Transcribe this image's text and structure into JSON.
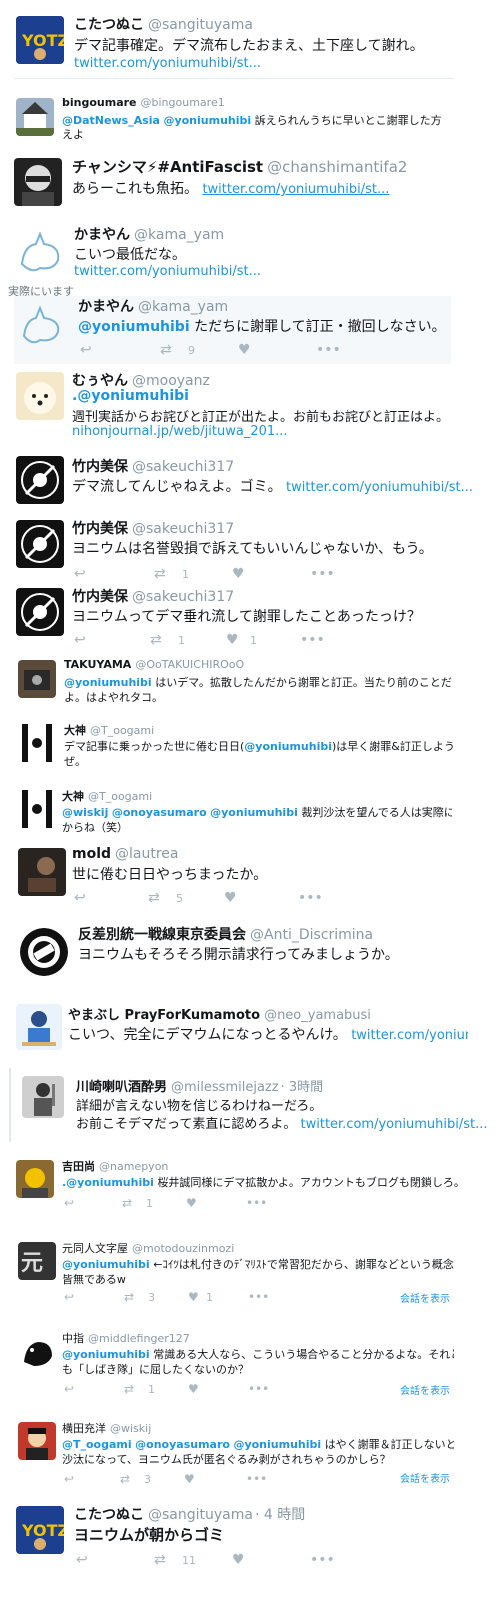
{
  "tweets": [
    {
      "name": "こたつぬこ",
      "handle": "@sangituyama",
      "text": "デマ記事確定。デマ流布したおまえ、土下座して謝れ。",
      "link": "twitter.com/yoniumuhibi/st..."
    },
    {
      "name": "bingoumare",
      "handle": "@bingoumare1",
      "mention_a": "@DatNews_Asia",
      "mention_b": "@yoniumuhibi",
      "text": "訴えられんうちに早いとこ謝罪した方がえ",
      "text2": "えよ"
    },
    {
      "name": "チャンシマ⚡#AntiFascist",
      "handle": "@chanshimantifa2",
      "text": "あらーこれも魚拓。",
      "link": "twitter.com/yoniumuhibi/st..."
    },
    {
      "name": "かまやん",
      "handle": "@kama_yam",
      "text": "こいつ最低だな。",
      "link": "twitter.com/yoniumuhibi/st..."
    },
    {
      "name": "かまやん",
      "handle": "@kama_yam",
      "mention": "@yoniumuhibi",
      "text": "ただちに謝罪して訂正・撤回しなさい。",
      "retweets": "9"
    },
    {
      "name": "むぅやん",
      "handle": "@mooyanz",
      "mention": ".@yoniumuhibi",
      "text": "週刊実話からお詫びと訂正が出たよ。お前もお詫びと訂正はよ。",
      "link": "nihonjournal.jp/web/jituwa_201..."
    },
    {
      "name": "竹内美保",
      "handle": "@sakeuchi317",
      "text": "デマ流してんじゃねえよ。ゴミ。",
      "link": "twitter.com/yoniumuhibi/st..."
    },
    {
      "name": "竹内美保",
      "handle": "@sakeuchi317",
      "text": "ヨニウムは名誉毀損で訴えてもいいんじゃないか、もう。",
      "retweets": "1"
    },
    {
      "name": "竹内美保",
      "handle": "@sakeuchi317",
      "text": "ヨニウムってデマ垂れ流して謝罪したことあったっけ？",
      "retweets": "1",
      "likes": "1"
    },
    {
      "name": "TAKUYAMA",
      "handle": "@OoTAKUICHIROoO",
      "mention": "@yoniumuhibi",
      "text": "はいデマ。拡散したんだから謝罪と訂正。当たり前のことだ",
      "text2": "よ。はよやれタコ。"
    },
    {
      "name": "大神",
      "handle": "@T_oogami",
      "text_pre": "デマ記事に乗っかった世に倦む日日(",
      "mention": "@yoniumuhibi",
      "text": ")は早く謝罪&訂正しよう",
      "text2": "ぜ。"
    },
    {
      "name": "大神",
      "handle": "@T_oogami",
      "mention_a": "@wiskij",
      "mention_b": "@onoyasumaro",
      "mention_c": "@yoniumuhibi",
      "text": "裁判沙汰を望んでる人は実際にいます",
      "text2": "からね（笑）"
    },
    {
      "name": "mold",
      "handle": "@lautrea",
      "text": "世に倦む日日やっちまったか。",
      "retweets": "5"
    },
    {
      "name": "反差別統一戦線東京委員会",
      "handle": "@Anti_Discrimina",
      "text": "ヨニウムもそろそろ開示請求行ってみましょうか。"
    },
    {
      "name": "やまぶし PrayForKumamoto",
      "handle": "@neo_yamabusi",
      "text": "こいつ、完全にデマウムになっとるやんけ。",
      "link": "twitter.com/yoniumuhibi/s"
    },
    {
      "name": "川崎喇叭酒酔男",
      "handle": "@milessmilejazz",
      "time": "· 3時間",
      "text": "詳細が言えない物を信じるわけねーだろ。",
      "text2": "お前こそデマだって素直に認めろよ。",
      "link": "twitter.com/yoniumuhibi/st..."
    },
    {
      "name": "吉田尚",
      "handle": "@namepyon",
      "mention": ".@yoniumuhibi",
      "text": "桜井誠同様にデマ拡散かよ。アカウントもブログも閉鎖しろ。",
      "retweets": "1"
    },
    {
      "name": "元同人文字屋",
      "handle": "@motodouzinmozi",
      "mention": "@yoniumuhibi",
      "text": "←ｺｲﾂは札付きのﾃﾞﾏﾘｽﾄで常習犯だから、謝罪などという概念は",
      "text2": "皆無であるw",
      "retweets": "3",
      "likes": "1",
      "conv": "会話を表示"
    },
    {
      "name": "中指",
      "handle": "@middlefinger127",
      "mention": "@yoniumuhibi",
      "text": "常識ある大人なら、こういう場合やること分かるよな。それと",
      "text2": "も「しばき隊」に屈したくないのか？",
      "retweets": "1",
      "conv": "会話を表示"
    },
    {
      "name": "横田充洋",
      "handle": "@wiskij",
      "mention_a": "@T_oogami",
      "mention_b": "@onoyasumaro",
      "mention_c": "@yoniumuhibi",
      "text": "はやく謝罪＆訂正しないと、裁判",
      "text2": "沙汰になって、ヨニウム氏が匿名ぐるみ剥がされちゃうのかしら？",
      "retweets": "3",
      "conv": "会話を表示"
    },
    {
      "name": "こたつぬこ",
      "handle": "@sangituyama",
      "time": "· 4 時間",
      "text": "ヨニウムが朝からゴミ",
      "retweets": "11"
    }
  ],
  "clip_note": "実際にいます",
  "colors": {
    "link": "#1b95e0",
    "muted": "#8899a6",
    "bg_highlight": "#f5f8fa"
  }
}
